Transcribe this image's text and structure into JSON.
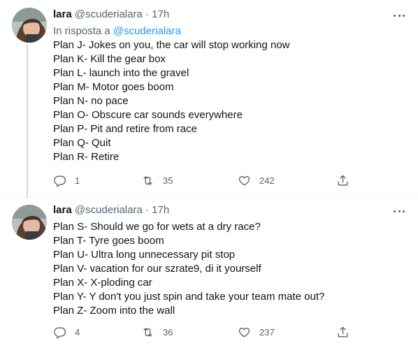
{
  "tweets": [
    {
      "author_name": "lara",
      "handle": "@scuderialara",
      "separator": "·",
      "time": "17h",
      "reply_prefix": "In risposta a",
      "reply_mention": "@scuderialara",
      "lines": [
        "Plan J- Jokes on you, the car will stop working now",
        "Plan K- Kill the gear box",
        "Plan L- launch into the gravel",
        "Plan M- Motor goes boom",
        "Plan N- no pace",
        "Plan O- Obscure car sounds everywhere",
        "Plan P- Pit and retire from race",
        "Plan Q- Quit",
        "Plan R- Retire"
      ],
      "reply_count": "1",
      "retweet_count": "35",
      "like_count": "242"
    },
    {
      "author_name": "lara",
      "handle": "@scuderialara",
      "separator": "·",
      "time": "17h",
      "lines": [
        "Plan S- Should we go for wets at a dry race?",
        "Plan T- Tyre goes boom",
        "Plan U- Ultra long unnecessary pit stop",
        "Plan V- vacation for our szrate9, di it yourself",
        "Plan X- X-ploding car",
        "Plan Y- Y don't you just spin and take your team mate out?",
        "Plan Z- Zoom into the wall"
      ],
      "reply_count": "4",
      "retweet_count": "36",
      "like_count": "237"
    }
  ],
  "icons": {
    "more": "more-icon",
    "reply": "reply-icon",
    "retweet": "retweet-icon",
    "like": "heart-icon",
    "share": "share-icon"
  },
  "colors": {
    "text": "#0f1419",
    "secondary": "#536471",
    "link": "#1d9bf0",
    "thread_line": "#cfd9de",
    "divider": "#eff3f4"
  }
}
